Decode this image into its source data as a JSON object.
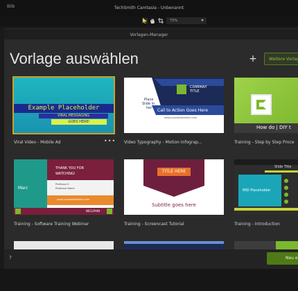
{
  "app": {
    "menu_label": "Bilb",
    "window_title": "TechSmith Camtasia - Unbenannt",
    "zoom": "73%"
  },
  "dialog": {
    "title": "Vorlagen-Manager",
    "heading": "Vorlage auswählen",
    "plus_label": "+",
    "more_templates_label": "Weitere Vorlag",
    "help_label": "?",
    "new_button_label": "Neu er"
  },
  "templates": [
    {
      "label": "Viral Video - Mobile Ad",
      "more": "•••",
      "thumb": {
        "line1": "Example Placeholder",
        "line2": "VIRAL MESSAGING",
        "line3": "GOES HERE!"
      }
    },
    {
      "label": "Video Typography - Motion Infograp...",
      "thumb": {
        "place": "Place",
        "slide": "Slide in",
        "her": "her",
        "company": "COMPANY",
        "title": "TITLE",
        "cta": "Call to Action Goes Here",
        "url": "www.yourwebsitehere.com"
      }
    },
    {
      "label": "Training - Step by Step Proce",
      "thumb": {
        "howto": "How do | DIY t"
      }
    },
    {
      "label": "Training - Software Training Webinar",
      "thumb": {
        "thanks1": "THANK YOU FOR",
        "thanks2": "WATCHING!",
        "name1": "Professor X",
        "name2": "Professor Name",
        "url": "www.yourwebsitehere.com",
        "left": "Marc",
        "badge": "NECLPHIN"
      }
    },
    {
      "label": "Training - Screencast Tutorial",
      "thumb": {
        "title": "TITLE HERE",
        "subtitle": "Subtitle goes here"
      }
    },
    {
      "label": "Training - Introduction",
      "thumb": {
        "slide_title": "Slide Title",
        "placeholder": "MID Placeholder"
      }
    }
  ],
  "colors": {
    "accent_green": "#7cb82f",
    "selection": "#c9a22a",
    "teal": "#1fa7b5",
    "navy": "#1b2a57",
    "maroon": "#7a1f3c"
  }
}
